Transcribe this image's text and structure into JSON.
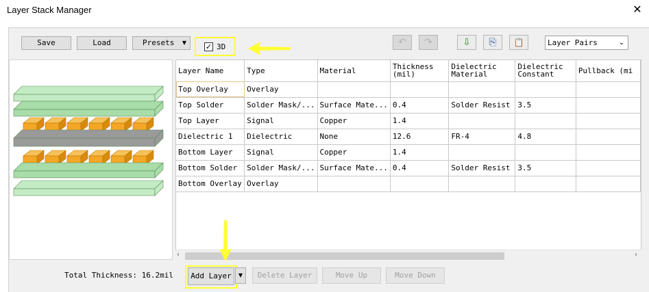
{
  "window": {
    "title": "Layer Stack Manager",
    "close_glyph": "✕"
  },
  "toolbar": {
    "save_label": "Save",
    "load_label": "Load",
    "presets_label": "Presets",
    "presets_caret": "▼",
    "view_3d_label": "3D",
    "view_3d_checked": true,
    "check_glyph": "✓",
    "icons": {
      "undo": "↶",
      "redo": "↷",
      "import": "⇩",
      "copy": "⎘",
      "paste": "📋"
    },
    "layer_pairs_label": "Layer Pairs",
    "layer_pairs_caret": "⌄"
  },
  "grid": {
    "headers": [
      "Layer Name",
      "Type",
      "Material",
      "Thickness (mil)",
      "Dielectric Material",
      "Dielectric Constant",
      "Pullback (mi"
    ],
    "rows": [
      [
        "Top Overlay",
        "Overlay",
        "",
        "",
        "",
        "",
        ""
      ],
      [
        "Top Solder",
        "Solder Mask/...",
        "Surface Mate...",
        "0.4",
        "Solder Resist",
        "3.5",
        ""
      ],
      [
        "Top Layer",
        "Signal",
        "Copper",
        "1.4",
        "",
        "",
        ""
      ],
      [
        "Dielectric 1",
        "Dielectric",
        "None",
        "12.6",
        "FR-4",
        "4.8",
        ""
      ],
      [
        "Bottom Layer",
        "Signal",
        "Copper",
        "1.4",
        "",
        "",
        ""
      ],
      [
        "Bottom Solder",
        "Solder Mask/...",
        "Surface Mate...",
        "0.4",
        "Solder Resist",
        "3.5",
        ""
      ],
      [
        "Bottom Overlay",
        "Overlay",
        "",
        "",
        "",
        "",
        ""
      ]
    ]
  },
  "scroll": {
    "left_glyph": "‹",
    "right_glyph": "›"
  },
  "footer": {
    "total_thickness": "Total Thickness: 16.2mil",
    "add_layer_label": "Add Layer",
    "add_layer_caret": "▼",
    "delete_layer_label": "Delete Layer",
    "move_up_label": "Move Up",
    "move_down_label": "Move Down"
  },
  "colors": {
    "overlay": "#c4ecc4",
    "solder": "#a8dca8",
    "copper": "#f4a626",
    "dielectric": "#9a9a9a",
    "highlight": "#ffff33"
  }
}
